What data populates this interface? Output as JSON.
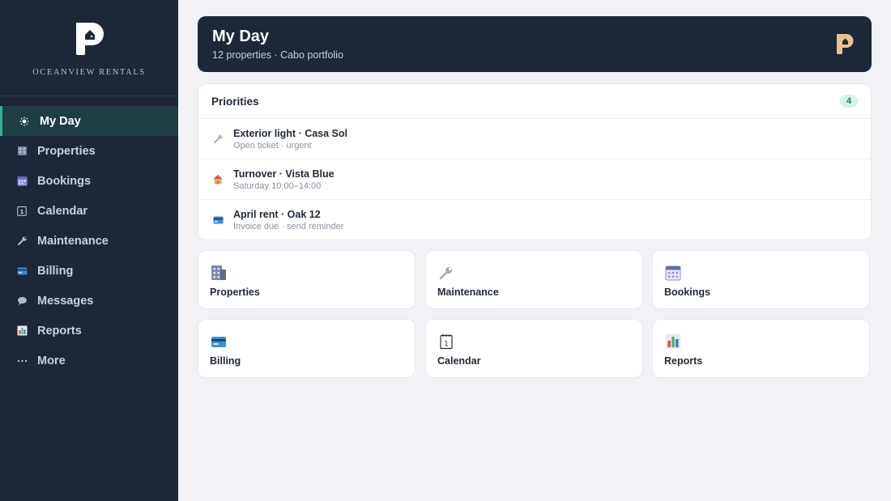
{
  "brand": {
    "name": "OCEANVIEW RENTALS"
  },
  "sidebar": {
    "items": [
      {
        "label": "My Day",
        "icon": "sun-icon",
        "active": true
      },
      {
        "label": "Properties",
        "icon": "building-icon"
      },
      {
        "label": "Bookings",
        "icon": "calendar-grid-icon"
      },
      {
        "label": "Calendar",
        "icon": "calendar-day-icon"
      },
      {
        "label": "Maintenance",
        "icon": "wrench-icon"
      },
      {
        "label": "Billing",
        "icon": "credit-card-icon"
      },
      {
        "label": "Messages",
        "icon": "speech-bubble-icon"
      },
      {
        "label": "Reports",
        "icon": "bar-chart-icon"
      },
      {
        "label": "More",
        "icon": "ellipsis-icon"
      }
    ]
  },
  "header": {
    "title": "My Day",
    "subtitle": "12 properties · Cabo portfolio"
  },
  "priorities": {
    "title": "Priorities",
    "count": "4",
    "items": [
      {
        "title": "Exterior light · Casa Sol",
        "detail": "Open ticket · urgent",
        "icon": "wrench-icon"
      },
      {
        "title": "Turnover · Vista Blue",
        "detail": "Saturday 10:00–14:00",
        "icon": "house-icon"
      },
      {
        "title": "April rent · Oak 12",
        "detail": "Invoice due · send reminder",
        "icon": "credit-card-icon"
      }
    ]
  },
  "tiles": [
    {
      "label": "Properties",
      "icon": "building-icon"
    },
    {
      "label": "Maintenance",
      "icon": "wrench-icon"
    },
    {
      "label": "Bookings",
      "icon": "calendar-grid-icon"
    },
    {
      "label": "Billing",
      "icon": "credit-card-icon"
    },
    {
      "label": "Calendar",
      "icon": "calendar-day-icon"
    },
    {
      "label": "Reports",
      "icon": "bar-chart-icon"
    }
  ],
  "colors": {
    "sidebar_bg": "#1c2838",
    "accent": "#2fb38d",
    "logo_gold": "#e8c48a",
    "badge_bg": "#d8f2e7"
  }
}
